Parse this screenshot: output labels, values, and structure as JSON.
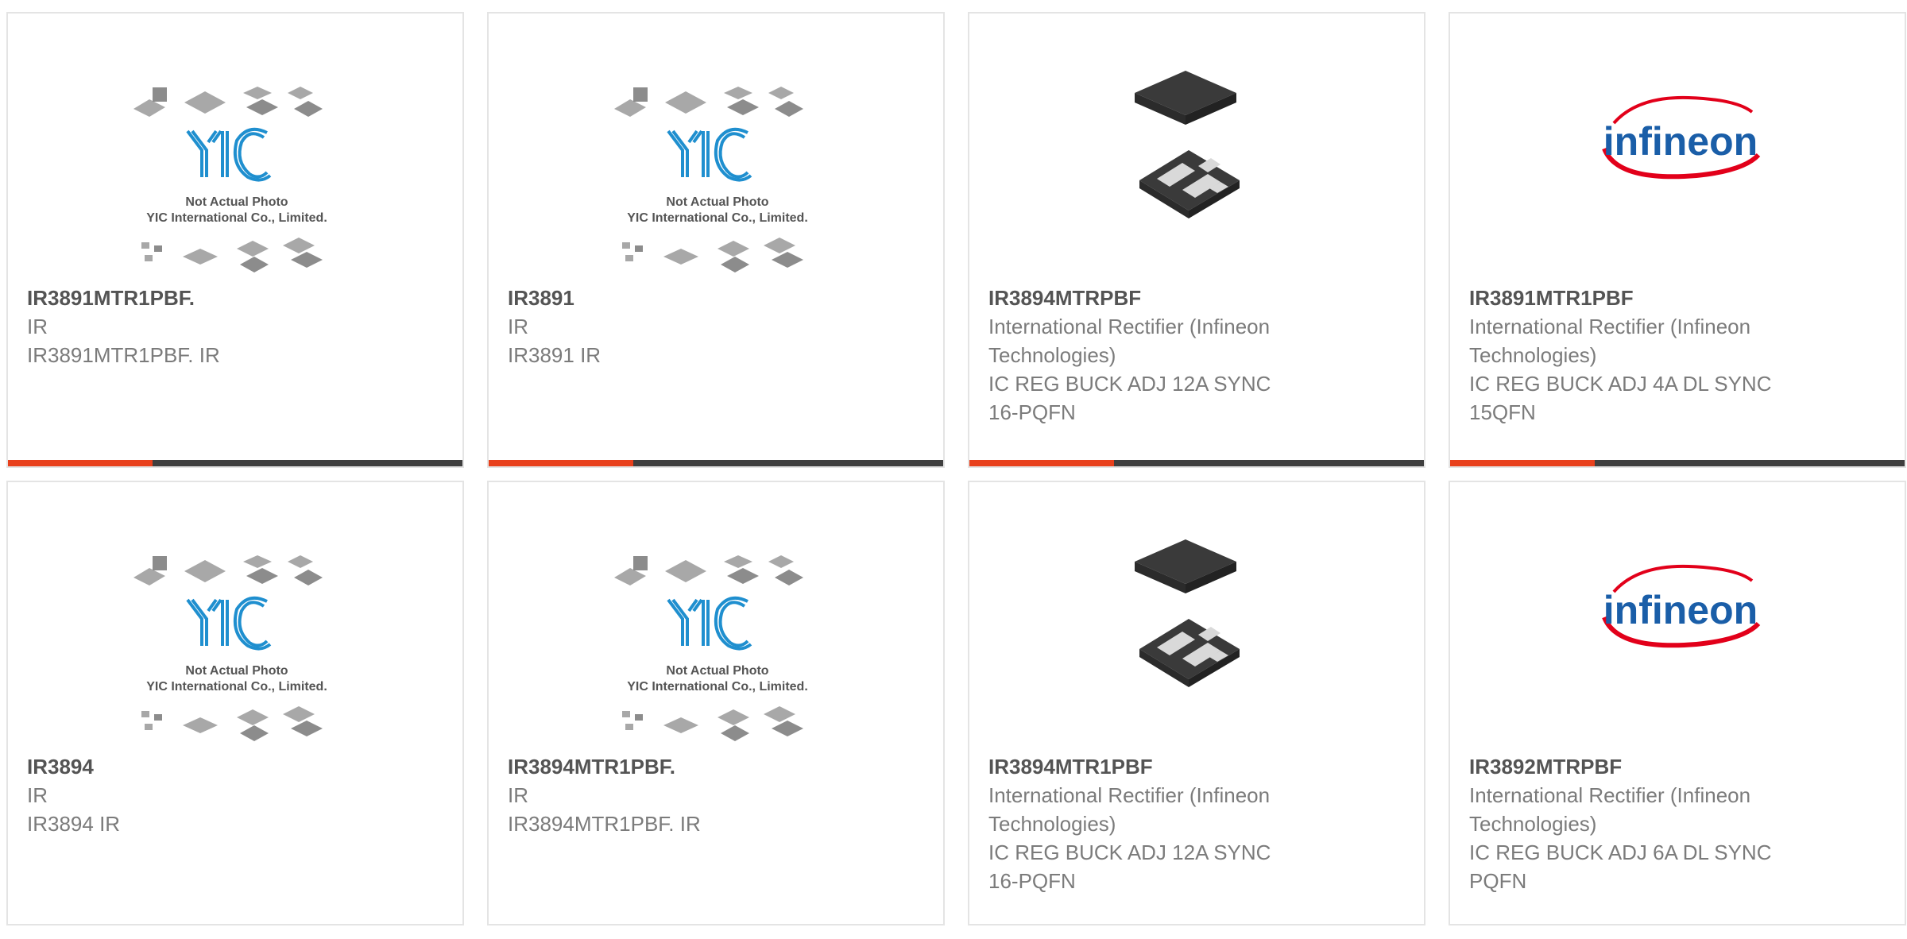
{
  "products": [
    {
      "part": "IR3891MTR1PBF.",
      "lines": [
        "IR",
        "IR3891MTR1PBF. IR"
      ],
      "image": "placeholder"
    },
    {
      "part": "IR3891",
      "lines": [
        "IR",
        "IR3891 IR"
      ],
      "image": "placeholder"
    },
    {
      "part": "IR3894MTRPBF",
      "lines": [
        "International Rectifier (Infineon",
        "Technologies)",
        "IC REG BUCK ADJ 12A SYNC",
        "16-PQFN"
      ],
      "image": "chip"
    },
    {
      "part": "IR3891MTR1PBF",
      "lines": [
        "International Rectifier (Infineon",
        "Technologies)",
        "IC REG BUCK ADJ 4A DL SYNC",
        "15QFN"
      ],
      "image": "infineon"
    },
    {
      "part": "IR3894",
      "lines": [
        "IR",
        "IR3894 IR"
      ],
      "image": "placeholder"
    },
    {
      "part": "IR3894MTR1PBF.",
      "lines": [
        "IR",
        "IR3894MTR1PBF. IR"
      ],
      "image": "placeholder"
    },
    {
      "part": "IR3894MTR1PBF",
      "lines": [
        "International Rectifier (Infineon",
        "Technologies)",
        "IC REG BUCK ADJ 12A SYNC",
        "16-PQFN"
      ],
      "image": "chip"
    },
    {
      "part": "IR3892MTRPBF",
      "lines": [
        "International Rectifier (Infineon",
        "Technologies)",
        "IC REG BUCK ADJ 6A DL SYNC",
        "PQFN"
      ],
      "image": "infineon"
    }
  ],
  "placeholder": {
    "logo_text": "YIC",
    "caption_line1": "Not Actual Photo",
    "caption_line2": "YIC International Co., Limited."
  },
  "infineon_logo_text": "infineon",
  "colors": {
    "accent": "#e8401c",
    "bar": "#3f3f3f",
    "yic_blue": "#1f8fcf",
    "infineon_blue": "#1a5ea8",
    "infineon_red": "#e2001a"
  }
}
